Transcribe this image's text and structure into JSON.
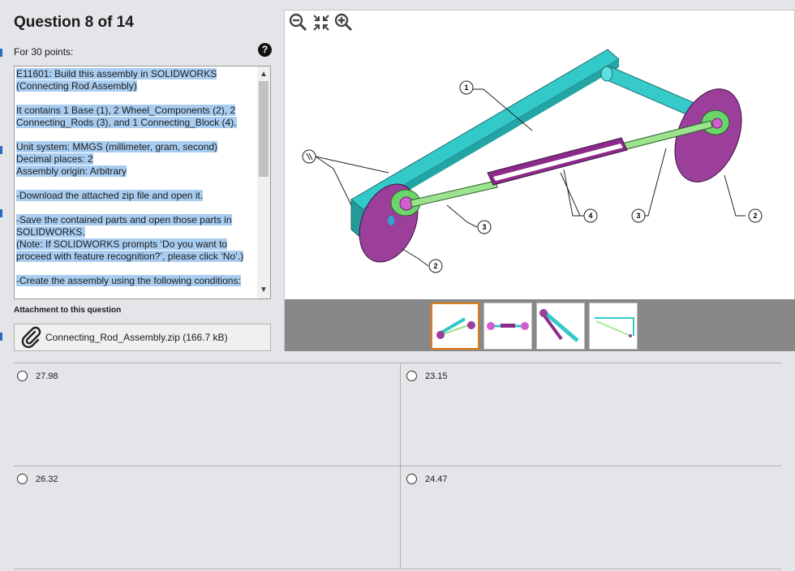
{
  "header": {
    "title": "Question 8 of 14",
    "points": "For 30 points:",
    "help_glyph": "?"
  },
  "description": [
    "E11601:  Build this assembly in SOLIDWORKS (Connecting Rod Assembly)",
    "It contains 1 Base (1), 2 Wheel_Components (2), 2 Connecting_Rods (3), and 1 Connecting_Block (4).",
    "Unit system: MMGS (millimeter, gram, second)\nDecimal places: 2\nAssembly origin: Arbitrary",
    "-Download the attached zip file and open it.",
    "-Save the contained parts and open those parts in SOLIDWORKS.\n(Note: If SOLIDWORKS prompts ‘Do you want to proceed with feature recognition?’, please click ‘No’.)",
    "-Create the assembly using the following conditions:"
  ],
  "attachment": {
    "label": "Attachment to this question",
    "file": "Connecting_Rod_Assembly.zip (166.7 kB)",
    "icon": "paperclip-icon"
  },
  "viewer": {
    "tools": [
      "zoom-out-icon",
      "fit-icon",
      "zoom-in-icon"
    ],
    "callouts": [
      "1",
      "2",
      "2",
      "3",
      "3",
      "4",
      "3",
      "2"
    ],
    "thumbnails": 4,
    "active_thumbnail": 0,
    "colors": {
      "base": "#33c9c9",
      "wheel": "#9b3f9b",
      "rod": "#9be38d",
      "block": "#8b2a8b",
      "pin": "#d25fd2",
      "selected": "#e07b16"
    }
  },
  "answers": [
    {
      "value": "27.98"
    },
    {
      "value": "23.15"
    },
    {
      "value": "26.32"
    },
    {
      "value": "24.47"
    }
  ]
}
